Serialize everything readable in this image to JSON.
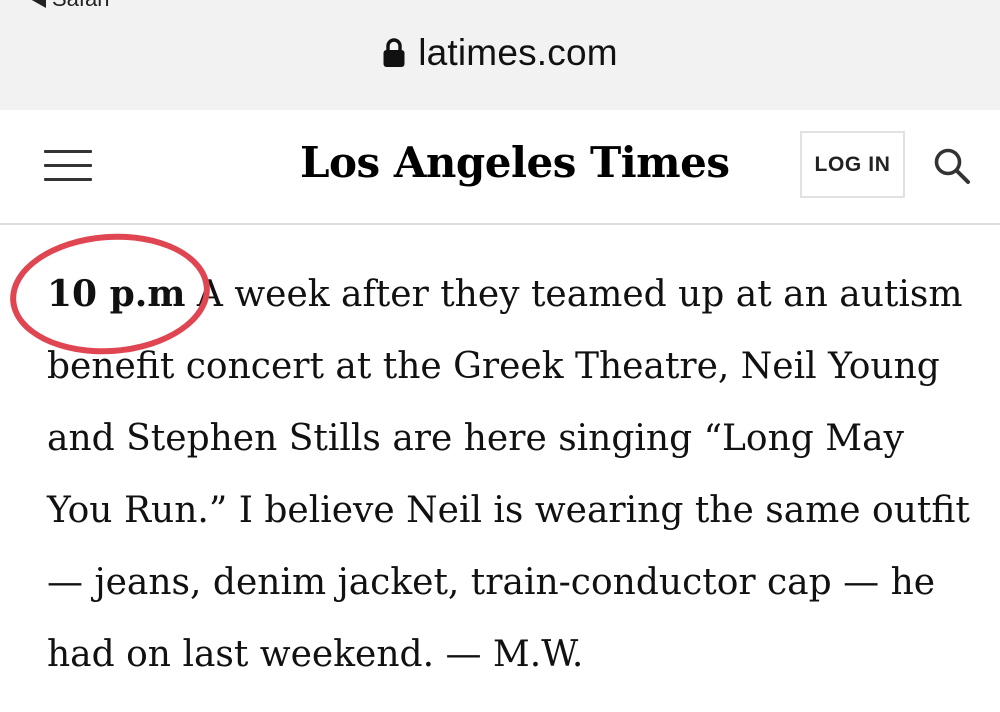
{
  "browser": {
    "back_label": "Safari",
    "url": "latimes.com",
    "lock_icon": "lock-icon"
  },
  "header": {
    "menu_icon": "hamburger-menu-icon",
    "logo_text": "Los Angeles Times",
    "login_label": "LOG IN",
    "search_icon": "search-icon"
  },
  "article": {
    "timestamp": "10 p.m",
    "body": " A week after they teamed up at an autism benefit concert at the Greek Theatre, Neil Young and Stephen Stills are here singing “Long May You Run.” I believe Neil is wearing the same outfit — jeans, denim jacket, train-conductor cap — he had on last weekend. — M.W."
  },
  "annotation": {
    "circle_color": "#e04651"
  }
}
